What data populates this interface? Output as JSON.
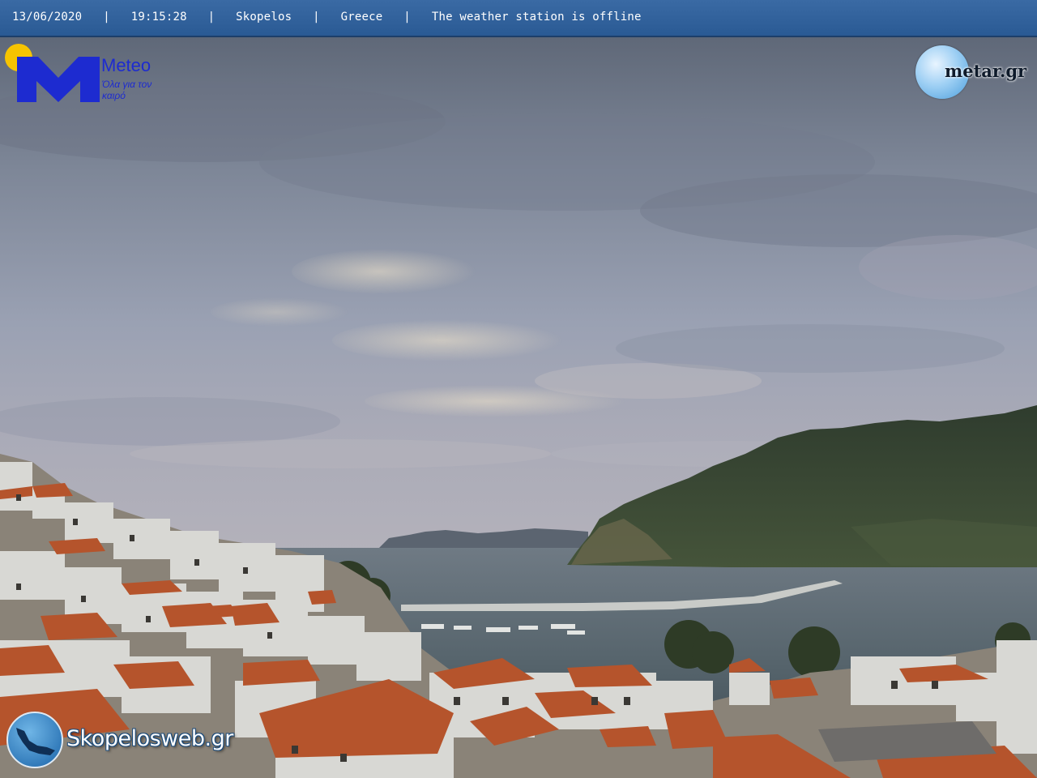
{
  "header": {
    "date": "13/06/2020",
    "time": "19:15:28",
    "location": "Skopelos",
    "country": "Greece",
    "status": "The weather station is offline",
    "separator": "|"
  },
  "logos": {
    "meteo": {
      "name": "Meteo",
      "slogan": "Όλα για τον καιρό"
    },
    "metar": {
      "name": "metar.gr"
    },
    "skopelosweb": {
      "name": "Skopelosweb.gr"
    }
  },
  "colors": {
    "header_bar": "#2f5f99",
    "meteo_blue": "#1d2bd0",
    "meteo_sun": "#f6c400",
    "sky": "#8a93a6",
    "sea": "#4d5e66",
    "roof_tiles": "#b5542c",
    "hillside": "#3a4a33"
  }
}
